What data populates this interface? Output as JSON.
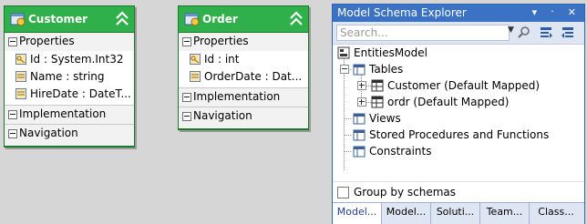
{
  "entities": [
    {
      "title": "Customer",
      "properties_label": "Properties",
      "properties": [
        "Id : System.Int32",
        "Name : string",
        "HireDate : DateT..."
      ],
      "implementation_label": "Implementation",
      "navigation_label": "Navigation"
    },
    {
      "title": "Order",
      "properties_label": "Properties",
      "properties": [
        "Id : int",
        "OrderDate : Dat..."
      ],
      "implementation_label": "Implementation",
      "navigation_label": "Navigation"
    }
  ],
  "explorer": {
    "title": "Model Schema Explorer",
    "title_buttons": "▾ ᛫ ✕",
    "search_placeholder": "Search...",
    "tree": {
      "root": "EntitiesModel",
      "tables": "Tables",
      "table_items": [
        "Customer (Default Mapped)",
        "ordr (Default Mapped)"
      ],
      "views": "Views",
      "stored_procedures": "Stored Procedures and Functions",
      "constraints": "Constraints"
    },
    "group_by_label": "Group by schemas",
    "tabs": [
      "Model...",
      "Model...",
      "Soluti...",
      "Team...",
      "Class..."
    ]
  },
  "colors": {
    "entity_header": "#2fb04a",
    "entity_border": "#1b7a2a",
    "panel_title": "#3b72c4"
  }
}
